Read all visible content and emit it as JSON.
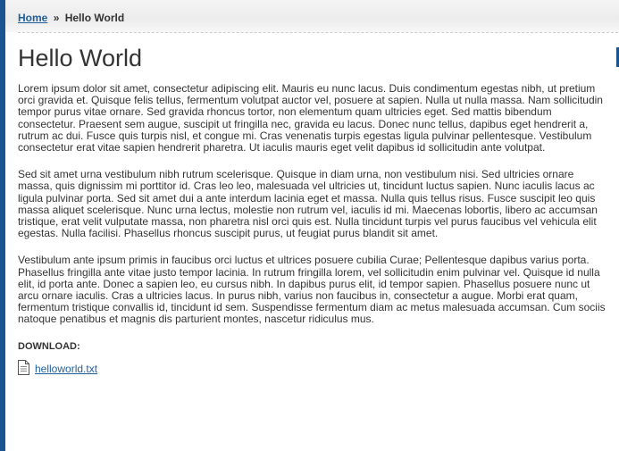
{
  "breadcrumb": {
    "home_label": "Home",
    "separator": "»",
    "current": "Hello World"
  },
  "page": {
    "title": "Hello World",
    "paragraphs": [
      "Lorem ipsum dolor sit amet, consectetur adipiscing elit. Mauris eu nunc lacus. Duis condimentum egestas nibh, ut pretium orci gravida et. Quisque felis tellus, fermentum volutpat auctor vel, posuere at sapien. Nulla ut nulla massa. Nam sollicitudin tempor purus vitae ornare. Sed gravida rhoncus tortor, non elementum quam ultricies eget. Sed mattis bibendum consectetur. Praesent sem augue, suscipit ut fringilla nec, gravida eu lacus. Donec nunc tellus, dapibus eget hendrerit a, rutrum ac dui. Fusce quis turpis nisl, et congue mi. Cras venenatis turpis egestas ligula pulvinar pellentesque. Vestibulum consectetur erat vitae sapien hendrerit pharetra. Ut iaculis mauris eget velit dapibus id sollicitudin ante volutpat.",
      "Sed sit amet urna vestibulum nibh rutrum scelerisque. Quisque in diam urna, non vestibulum nisi. Sed ultricies ornare massa, quis dignissim mi porttitor id. Cras leo leo, malesuada vel ultricies ut, tincidunt luctus sapien. Nunc iaculis lacus ac ligula pulvinar porta. Sed sit amet dui a ante interdum lacinia eget et massa. Nulla quis tellus risus. Fusce suscipit leo quis massa aliquet scelerisque. Nunc urna lectus, molestie non rutrum vel, iaculis id mi. Maecenas lobortis, libero ac accumsan tristique, erat velit vulputate massa, non pharetra nisl orci quis est. Nulla tincidunt turpis vel purus faucibus vel vehicula elit egestas. Nulla facilisi. Phasellus rhoncus suscipit purus, ut feugiat purus blandit sit amet.",
      "Vestibulum ante ipsum primis in faucibus orci luctus et ultrices posuere cubilia Curae; Pellentesque dapibus varius porta. Phasellus fringilla ante vitae justo tempor lacinia. In rutrum fringilla lorem, vel sollicitudin enim pulvinar vel. Quisque id nulla elit, id porta ante. Donec a sapien leo, eu cursus nibh. In dapibus purus elit, id tempor sapien. Phasellus posuere nunc ut arcu ornare iaculis. Cras a ultricies lacus. In purus nibh, varius non faucibus in, consectetur a augue. Morbi erat quam, fermentum tristique convallis id, tincidunt id sem. Suspendisse fermentum diam ac metus malesuada accumsan. Cum sociis natoque penatibus et magnis dis parturient montes, nascetur ridiculus mus."
    ]
  },
  "download": {
    "label": "DOWNLOAD:",
    "file_name": "helloworld.txt",
    "icon": "document-icon"
  },
  "colors": {
    "accent": "#1b5590",
    "link": "#1f5f99",
    "text": "#333333"
  }
}
